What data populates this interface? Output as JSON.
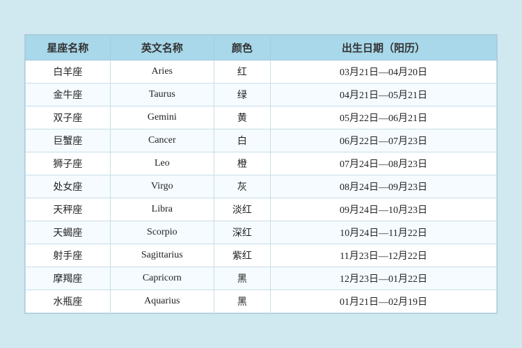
{
  "table": {
    "headers": [
      "星座名称",
      "英文名称",
      "颜色",
      "出生日期（阳历）"
    ],
    "rows": [
      {
        "cn": "白羊座",
        "en": "Aries",
        "color": "红",
        "date": "03月21日—04月20日"
      },
      {
        "cn": "金牛座",
        "en": "Taurus",
        "color": "绿",
        "date": "04月21日—05月21日"
      },
      {
        "cn": "双子座",
        "en": "Gemini",
        "color": "黄",
        "date": "05月22日—06月21日"
      },
      {
        "cn": "巨蟹座",
        "en": "Cancer",
        "color": "白",
        "date": "06月22日—07月23日"
      },
      {
        "cn": "狮子座",
        "en": "Leo",
        "color": "橙",
        "date": "07月24日—08月23日"
      },
      {
        "cn": "处女座",
        "en": "Virgo",
        "color": "灰",
        "date": "08月24日—09月23日"
      },
      {
        "cn": "天秤座",
        "en": "Libra",
        "color": "淡红",
        "date": "09月24日—10月23日"
      },
      {
        "cn": "天蝎座",
        "en": "Scorpio",
        "color": "深红",
        "date": "10月24日—11月22日"
      },
      {
        "cn": "射手座",
        "en": "Sagittarius",
        "color": "紫红",
        "date": "11月23日—12月22日"
      },
      {
        "cn": "摩羯座",
        "en": "Capricorn",
        "color": "黑",
        "date": "12月23日—01月22日"
      },
      {
        "cn": "水瓶座",
        "en": "Aquarius",
        "color": "黑",
        "date": "01月21日—02月19日"
      }
    ]
  }
}
